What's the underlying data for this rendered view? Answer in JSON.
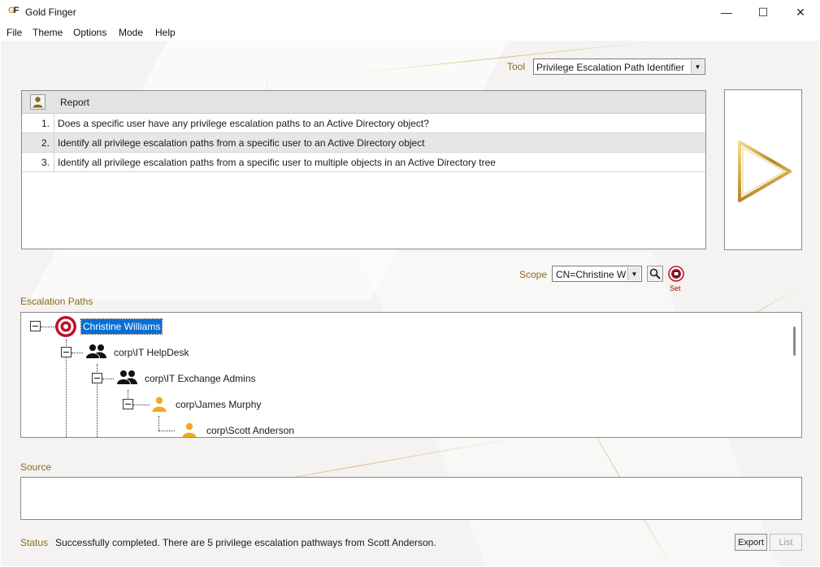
{
  "window": {
    "logo_text": "GF",
    "title": "Gold Finger",
    "controls": {
      "minimize": "—",
      "maximize": "☐",
      "close": "✕"
    }
  },
  "menu": [
    "File",
    "Theme",
    "Options",
    "Mode",
    "Help"
  ],
  "tool": {
    "label": "Tool",
    "selected": "Privilege Escalation Path Identifier"
  },
  "report": {
    "header_label": "Report",
    "header_icon": "user-icon",
    "rows": [
      {
        "num": "1.",
        "text": "Does a specific user have any privilege escalation paths to an Active Directory object?",
        "selected": false
      },
      {
        "num": "2.",
        "text": "Identify all privilege escalation paths from a specific user to an Active Directory object",
        "selected": true
      },
      {
        "num": "3.",
        "text": "Identify all privilege escalation paths from a specific user to multiple objects in an Active Directory tree",
        "selected": false
      }
    ]
  },
  "run_button": {
    "icon": "play-icon"
  },
  "scope": {
    "label": "Scope",
    "selected": "CN=Christine Williams",
    "search_icon": "search-icon",
    "set_label": "Set",
    "set_icon": "target-set-icon"
  },
  "escalation": {
    "label": "Escalation Paths",
    "nodes": [
      {
        "label": "Christine Williams",
        "icon": "target-icon",
        "selected": true
      },
      {
        "label": "corp\\IT HelpDesk",
        "icon": "group-icon"
      },
      {
        "label": "corp\\IT Exchange Admins",
        "icon": "group-icon"
      },
      {
        "label": "corp\\James Murphy",
        "icon": "user-icon"
      },
      {
        "label": "corp\\Scott Anderson",
        "icon": "user-icon"
      }
    ]
  },
  "source": {
    "label": "Source"
  },
  "status": {
    "label": "Status",
    "text": "Successfully completed. There are 5 privilege escalation pathways from Scott Anderson."
  },
  "buttons": {
    "export": "Export",
    "list": "List"
  },
  "colors": {
    "accent_gold": "#c8a22b",
    "selection_blue": "#0a6ed1",
    "user_orange": "#f4a81c",
    "target_red": "#c0102a"
  }
}
